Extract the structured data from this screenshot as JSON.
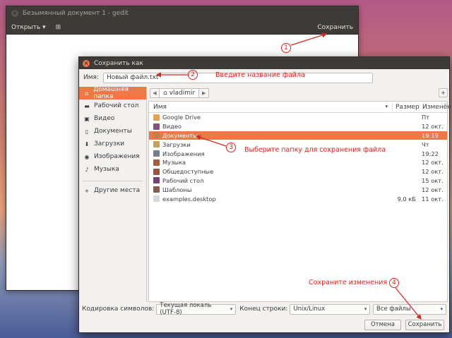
{
  "gedit": {
    "title": "Безымянный документ 1 - gedit",
    "open_label": "Открыть",
    "save_label": "Сохранить"
  },
  "dialog": {
    "title": "Сохранить как",
    "name_label": "Имя:",
    "name_value": "Новый файл.txt",
    "sidebar": [
      {
        "label": "Домашняя папка",
        "icon": "home-icon"
      },
      {
        "label": "Рабочий стол",
        "icon": "desktop-icon"
      },
      {
        "label": "Видео",
        "icon": "video-icon"
      },
      {
        "label": "Документы",
        "icon": "document-icon"
      },
      {
        "label": "Загрузки",
        "icon": "download-icon"
      },
      {
        "label": "Изображения",
        "icon": "camera-icon"
      },
      {
        "label": "Музыка",
        "icon": "music-icon"
      }
    ],
    "sidebar_other": "Другие места",
    "path_label": "vladimir",
    "columns": {
      "name": "Имя",
      "size": "Размер",
      "date": "Изменён"
    },
    "files": [
      {
        "name": "Google Drive",
        "size": "",
        "date": "Пт",
        "color": "#e8a14b"
      },
      {
        "name": "Видео",
        "size": "",
        "date": "12 окт.",
        "color": "#8a4f7d"
      },
      {
        "name": "Документы",
        "size": "",
        "date": "19:19",
        "color": "#c77b4a"
      },
      {
        "name": "Загрузки",
        "size": "",
        "date": "Чт",
        "color": "#c8a15a"
      },
      {
        "name": "Изображения",
        "size": "",
        "date": "19:22",
        "color": "#6f7f8f"
      },
      {
        "name": "Музыка",
        "size": "",
        "date": "12 окт.",
        "color": "#b05a3a"
      },
      {
        "name": "Общедоступные",
        "size": "",
        "date": "12 окт.",
        "color": "#a0523a"
      },
      {
        "name": "Рабочий стол",
        "size": "",
        "date": "15 окт.",
        "color": "#7a3e78"
      },
      {
        "name": "Шаблоны",
        "size": "",
        "date": "12 окт.",
        "color": "#8b5a4a"
      },
      {
        "name": "examples.desktop",
        "size": "9,0 кБ",
        "date": "11 окт.",
        "color": "#d9d9d9"
      }
    ],
    "encoding_label": "Кодировка символов:",
    "encoding_value": "Текущая локаль (UTF-8)",
    "line_end_label": "Конец строки:",
    "line_end_value": "Unix/Linux",
    "filter_value": "Все файлы",
    "cancel_label": "Отмена",
    "save_label": "Сохранить"
  },
  "annotations": {
    "step1": "1",
    "step2": "2",
    "step3": "3",
    "step4": "4",
    "text2": "Введите название файла",
    "text3": "Выберите папку для сохранения файла",
    "text4": "Сохраните изменения"
  },
  "colors": {
    "accent": "#f07746",
    "annotation": "#e0231c",
    "titlebar": "#3c3b37"
  }
}
